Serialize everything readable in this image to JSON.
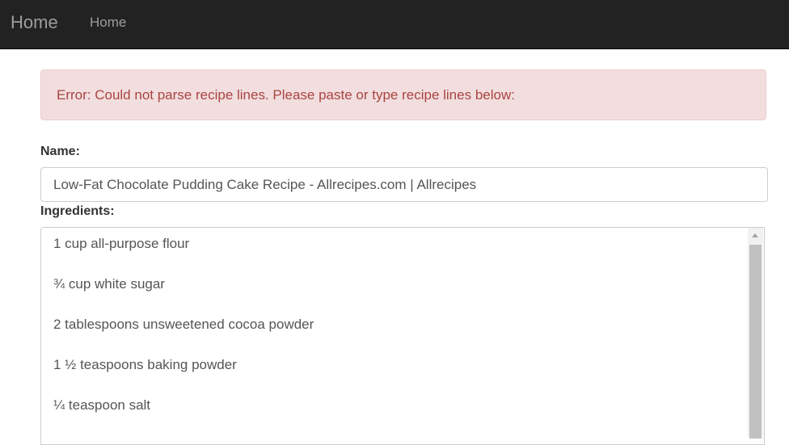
{
  "navbar": {
    "brand": "Home",
    "links": [
      "Home"
    ]
  },
  "alert": {
    "message": "Error: Could not parse recipe lines. Please paste or type recipe lines below:"
  },
  "form": {
    "name_label": "Name:",
    "name_value": "Low-Fat Chocolate Pudding Cake Recipe - Allrecipes.com | Allrecipes",
    "ingredients_label": "Ingredients:",
    "ingredients": [
      "1 cup all-purpose flour",
      "¾ cup white sugar",
      "2 tablespoons unsweetened cocoa powder",
      "1 ½ teaspoons baking powder",
      "¼ teaspoon salt"
    ]
  },
  "colors": {
    "navbar_bg": "#222222",
    "nav_text": "#9d9d9d",
    "alert_bg": "#f2dede",
    "alert_text": "#a94442"
  }
}
